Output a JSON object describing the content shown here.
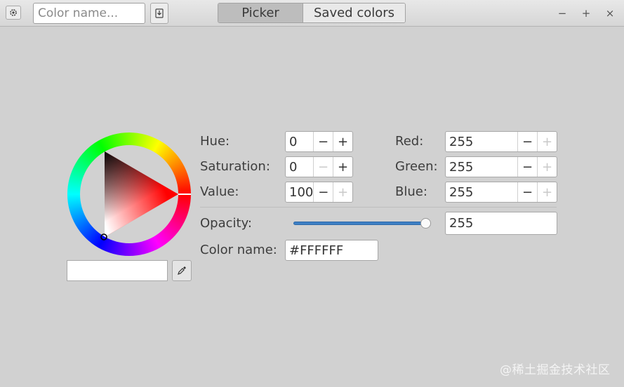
{
  "toolbar": {
    "menu_icon": "gear-icon",
    "search_placeholder": "Color name...",
    "save_icon": "download-icon"
  },
  "tabs": [
    {
      "label": "Picker",
      "active": true
    },
    {
      "label": "Saved colors",
      "active": false
    }
  ],
  "window_controls": {
    "minimize": "−",
    "maximize": "+",
    "close": "×"
  },
  "hsv": {
    "hue_label": "Hue:",
    "hue_value": "0",
    "saturation_label": "Saturation:",
    "saturation_value": "0",
    "value_label": "Value:",
    "value_value": "100"
  },
  "rgb": {
    "red_label": "Red:",
    "red_value": "255",
    "green_label": "Green:",
    "green_value": "255",
    "blue_label": "Blue:",
    "blue_value": "255"
  },
  "opacity": {
    "label": "Opacity:",
    "value": "255",
    "slider_fraction": 1.0
  },
  "color_name": {
    "label": "Color name:",
    "value": "#FFFFFF"
  },
  "spin_symbols": {
    "minus": "−",
    "plus": "+"
  },
  "preview_color": "#ffffff",
  "accent_color": "#3d7fc4",
  "watermark": "@稀土掘金技术社区"
}
